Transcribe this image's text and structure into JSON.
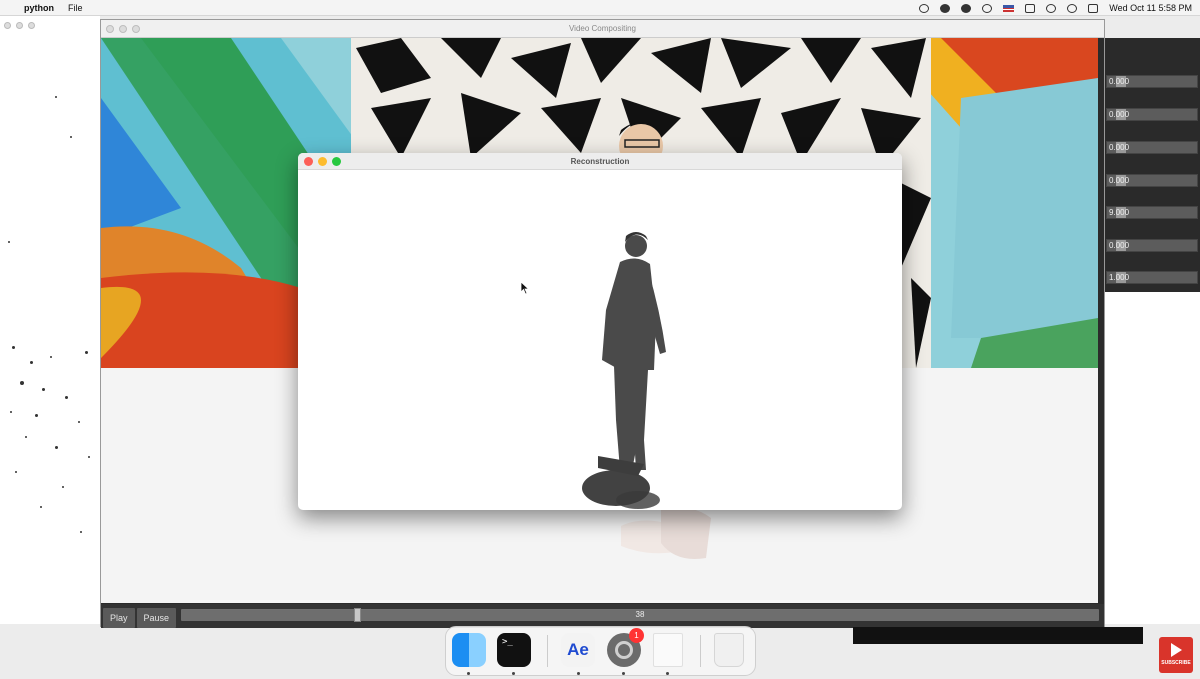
{
  "menubar": {
    "apple_icon": "apple-icon",
    "app_name": "python",
    "menus": [
      "File"
    ],
    "clock": "Wed Oct 11  5:58 PM"
  },
  "video_window": {
    "title": "Video Compositing",
    "controls": {
      "play_label": "Play",
      "pause_label": "Pause",
      "frame": "38",
      "progress_fraction": 0.19
    }
  },
  "reconstruction_window": {
    "title": "Reconstruction"
  },
  "parameter_panel": {
    "sliders": [
      {
        "value": "0.000",
        "level": 0.1
      },
      {
        "value": "0.000",
        "level": 0.1
      },
      {
        "value": "0.000",
        "level": 0.1
      },
      {
        "value": "0.000",
        "level": 0.1
      },
      {
        "value": "9.000",
        "level": 0.1
      },
      {
        "value": "0.000",
        "level": 0.1
      },
      {
        "value": "1.000",
        "level": 0.1
      }
    ]
  },
  "dock": {
    "apps": [
      "finder-icon",
      "terminal-icon",
      "after-effects-icon",
      "system-preferences-icon",
      "document-icon",
      "trash-icon"
    ],
    "terminal_glyph": ">_",
    "after_effects_label": "Ae",
    "prefs_badge": "1"
  },
  "overlay": {
    "subscribe_label": "SUBSCRIBE"
  },
  "colors": {
    "traffic_red": "#fc5f57",
    "traffic_yellow": "#fdbc2e",
    "traffic_green": "#28c840",
    "youtube_red": "#d9342b"
  }
}
